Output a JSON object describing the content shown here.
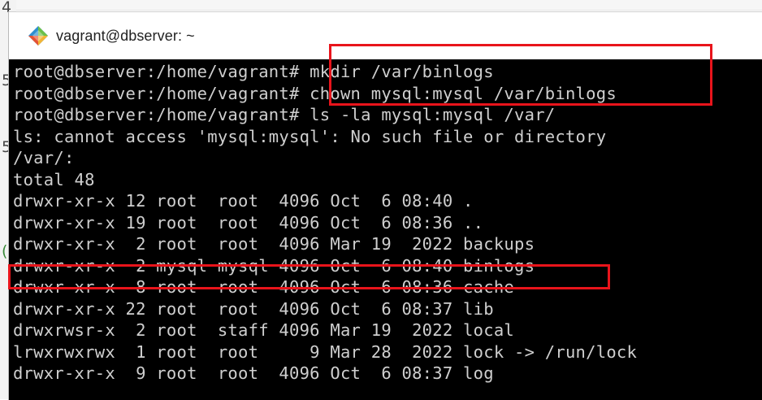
{
  "background_doc": {
    "chars": [
      "4",
      "5",
      "5",
      "(",
      "-"
    ]
  },
  "window": {
    "title": "vagrant@dbserver: ~",
    "icon": "gitbash-diamond-icon"
  },
  "terminal": {
    "lines": [
      "root@dbserver:/home/vagrant# mkdir /var/binlogs",
      "root@dbserver:/home/vagrant# chown mysql:mysql /var/binlogs",
      "root@dbserver:/home/vagrant# ls -la mysql:mysql /var/",
      "ls: cannot access 'mysql:mysql': No such file or directory",
      "/var/:",
      "total 48",
      "drwxr-xr-x 12 root  root  4096 Oct  6 08:40 .",
      "drwxr-xr-x 19 root  root  4096 Oct  6 08:36 ..",
      "drwxr-xr-x  2 root  root  4096 Mar 19  2022 backups",
      "drwxr-xr-x  2 mysql mysql 4096 Oct  6 08:40 binlogs",
      "drwxr-xr-x  8 root  root  4096 Oct  6 08:36 cache",
      "drwxr-xr-x 22 root  root  4096 Oct  6 08:37 lib",
      "drwxrwsr-x  2 root  staff 4096 Mar 19  2022 local",
      "lrwxrwxrwx  1 root  root     9 Mar 28  2022 lock -> /run/lock",
      "drwxr-xr-x  9 root  root  4096 Oct  6 08:37 log"
    ]
  },
  "colors": {
    "terminal_bg": "#000000",
    "terminal_fg": "#cfcfcf",
    "highlight": "#e8141b"
  }
}
